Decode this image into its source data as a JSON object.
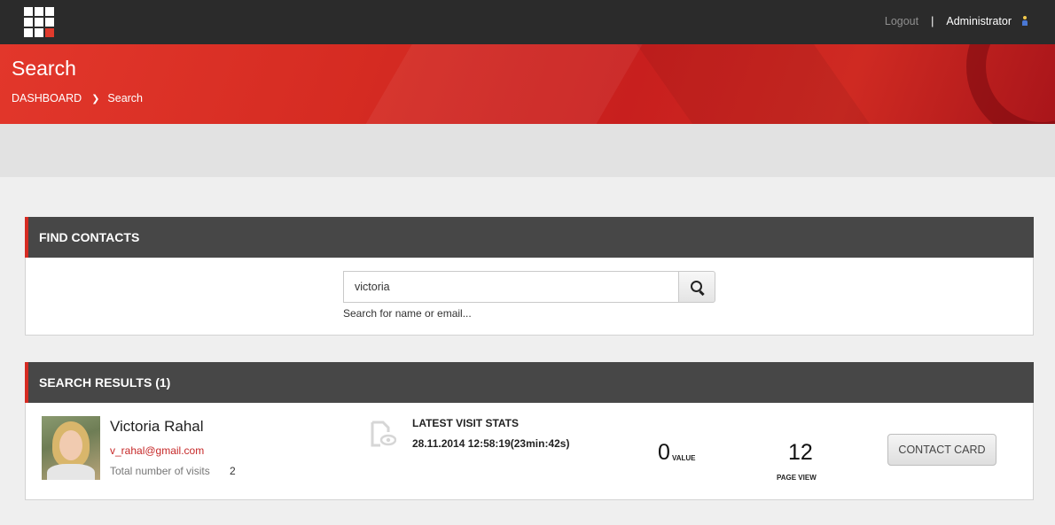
{
  "header": {
    "logout_label": "Logout",
    "separator": "|",
    "user_name": "Administrator"
  },
  "banner": {
    "title": "Search",
    "breadcrumb": {
      "root": "DASHBOARD",
      "current": "Search"
    }
  },
  "find_contacts": {
    "title": "FIND CONTACTS",
    "search_value": "victoria",
    "search_help": "Search for name or email..."
  },
  "results": {
    "title": "SEARCH RESULTS (1)",
    "items": [
      {
        "name": "Victoria Rahal",
        "email": "v_rahal@gmail.com",
        "visits_label": "Total number of visits",
        "visits_value": "2",
        "latest_title": "LATEST VISIT STATS",
        "latest_time": "28.11.2014 12:58:19(23min:42s)",
        "value_number": "0",
        "value_label": "VALUE",
        "page_view_number": "12",
        "page_view_label": "PAGE VIEW",
        "contact_card_label": "CONTACT CARD"
      }
    ]
  },
  "colors": {
    "accent": "#d52b22",
    "topbar": "#2b2b2b",
    "panel_header": "#474747"
  },
  "icons": [
    "app-grid-icon",
    "user-icon",
    "search-icon",
    "document-eye-icon"
  ]
}
